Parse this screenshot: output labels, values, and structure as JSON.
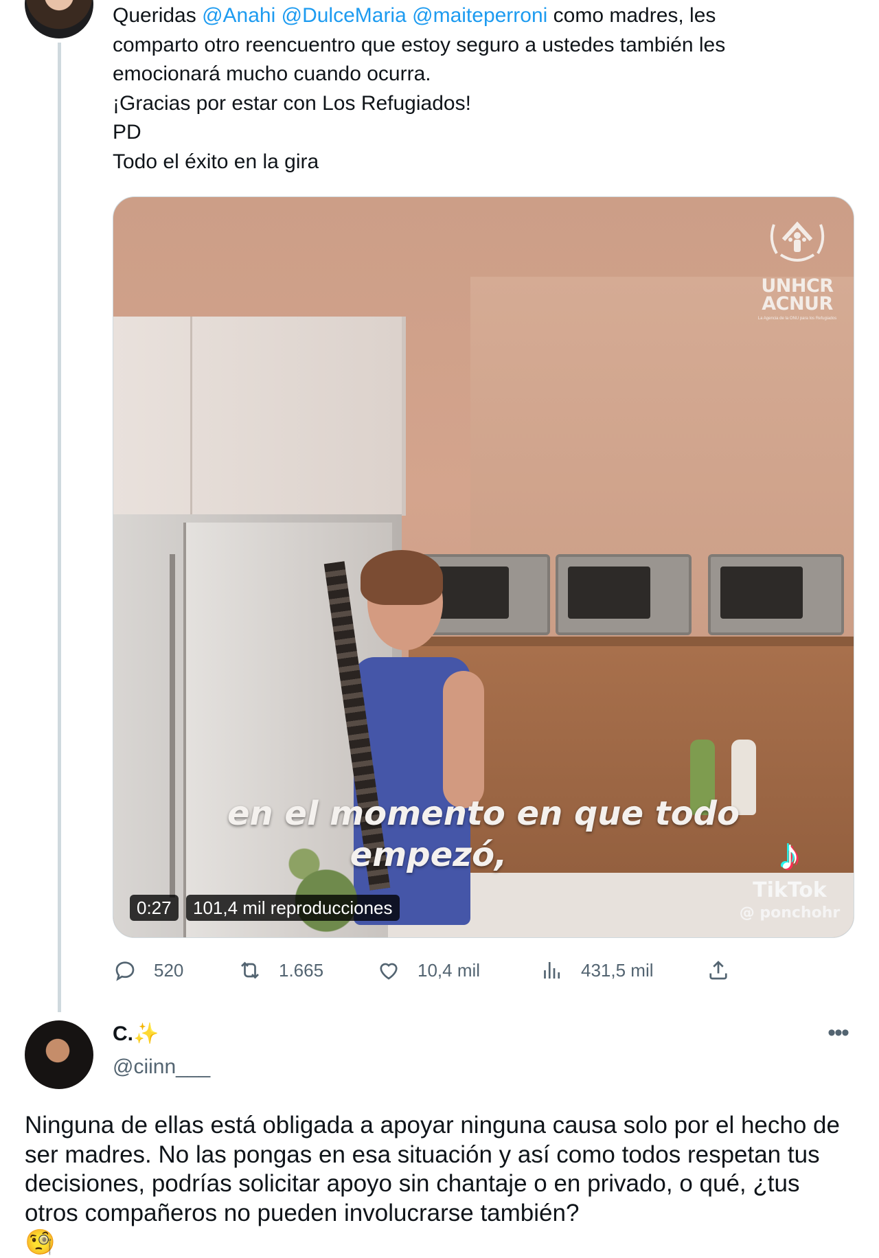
{
  "tweet": {
    "text_prefix": "Queridas ",
    "mentions": [
      "@Anahi",
      "@DulceMaria",
      "@maiteperroni"
    ],
    "text_after_mentions": " como madres, les\ncomparto otro reencuentro que estoy seguro a ustedes también les\nemocionará mucho cuando ocurra.\n¡Gracias por estar con Los Refugiados!\nPD\nTodo el éxito en la gira",
    "video": {
      "caption_line1": "en el momento en que todo",
      "caption_line2": "empezó,",
      "duration": "0:27",
      "views": "101,4 mil reproducciones",
      "watermark": {
        "org_name_1": "UNHCR",
        "org_name_2": "ACNUR",
        "org_sub": "La Agencia de la ONU para los Refugiados"
      },
      "tiktok": {
        "brand": "TikTok",
        "handle": "@ ponchohr"
      }
    },
    "actions": {
      "replies": "520",
      "retweets": "1.665",
      "likes": "10,4 mil",
      "views": "431,5 mil"
    },
    "icons": [
      "reply-icon",
      "retweet-icon",
      "like-icon",
      "views-icon",
      "share-icon"
    ]
  },
  "reply": {
    "display_name": "C.",
    "name_emoji": "✨",
    "handle": "@ciinn___",
    "text": "Ninguna de ellas está obligada a apoyar ninguna causa solo por el hecho de ser madres. No las pongas en esa situación y así como todos respetan tus decisiones, podrías solicitar apoyo sin chantaje o en privado, o qué, ¿tus otros compañeros no pueden involucrarse también?",
    "emoji": "🧐",
    "more_icon": "more-icon"
  },
  "colors": {
    "link": "#1d9bf0",
    "muted": "#536471",
    "text": "#0f1419",
    "thread_line": "#cfd9de"
  }
}
